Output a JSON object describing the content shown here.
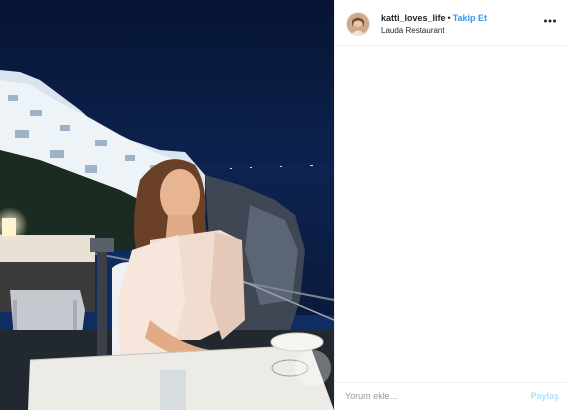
{
  "header": {
    "username": "katti_loves_life",
    "separator": "•",
    "follow_label": "Takip Et",
    "location": "Lauda Restaurant",
    "more_icon": "more-horizontal-icon"
  },
  "comment": {
    "placeholder": "Yorum ekle...",
    "share_label": "Paylaş"
  },
  "colors": {
    "accent": "#3897f0",
    "share_disabled": "#b2dffc",
    "border": "#efefef"
  }
}
